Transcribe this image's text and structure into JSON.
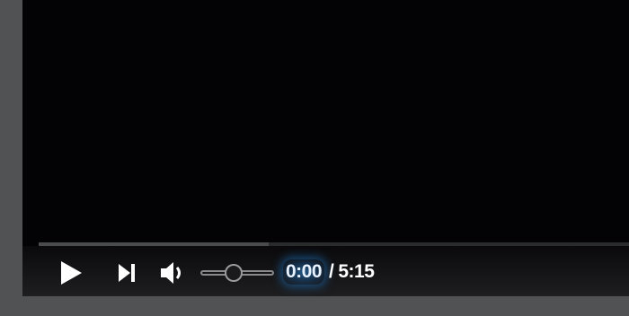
{
  "player": {
    "progress_fraction": 0.0,
    "buffered_fraction": 0.39,
    "volume_fraction": 0.45,
    "controls": {
      "play_icon": "play-icon",
      "next_icon": "skip-next-icon",
      "volume_icon": "volume-icon"
    },
    "time": {
      "current": "0:00",
      "separator": "/",
      "duration": "5:15"
    }
  },
  "colors": {
    "background": "#515253",
    "player": "#030305",
    "icon": "#ffffff",
    "time_highlight": "#1e78c8"
  }
}
